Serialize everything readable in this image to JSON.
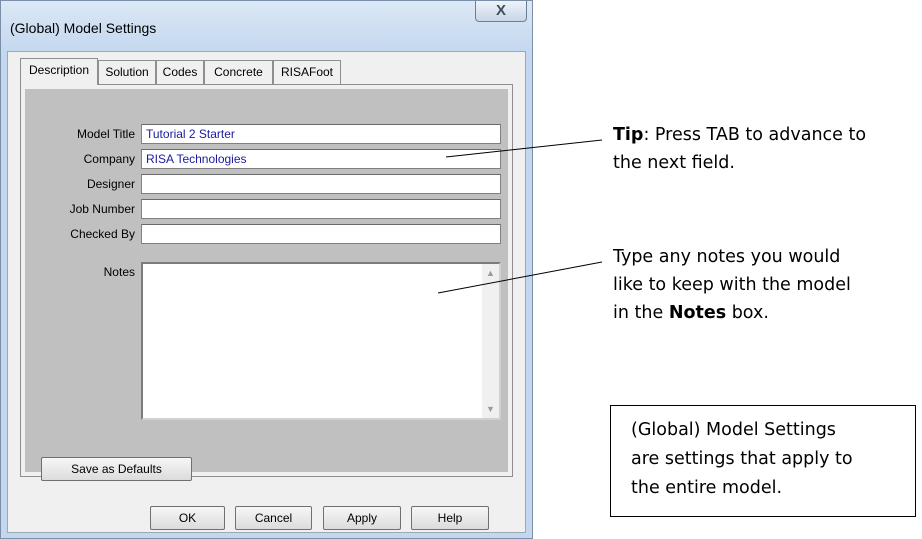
{
  "window": {
    "title": "(Global) Model Settings",
    "close_label": "X"
  },
  "tabs": [
    {
      "label": "Description",
      "active": true
    },
    {
      "label": "Solution"
    },
    {
      "label": "Codes"
    },
    {
      "label": "Concrete"
    },
    {
      "label": "RISAFoot"
    }
  ],
  "fields": {
    "model_title": {
      "label": "Model Title",
      "value": "Tutorial 2 Starter"
    },
    "company": {
      "label": "Company",
      "value": "RISA Technologies"
    },
    "designer": {
      "label": "Designer",
      "value": ""
    },
    "job_number": {
      "label": "Job Number",
      "value": ""
    },
    "checked_by": {
      "label": "Checked By",
      "value": ""
    },
    "notes": {
      "label": "Notes",
      "value": ""
    }
  },
  "buttons": {
    "save_defaults": "Save as Defaults",
    "ok": "OK",
    "cancel": "Cancel",
    "apply": "Apply",
    "help": "Help"
  },
  "annotations": {
    "tip_bold": "Tip",
    "tip_line1_rest": ": Press TAB to advance to",
    "tip_line2": "the next field.",
    "notes_line1": "Type any notes you would",
    "notes_line2": "like to keep with the model",
    "notes_line3_prefix": "in the ",
    "notes_line3_bold": "Notes",
    "notes_line3_suffix": " box.",
    "box_line1": "(Global) Model Settings",
    "box_line2": "are settings that apply to",
    "box_line3": "the entire model."
  }
}
